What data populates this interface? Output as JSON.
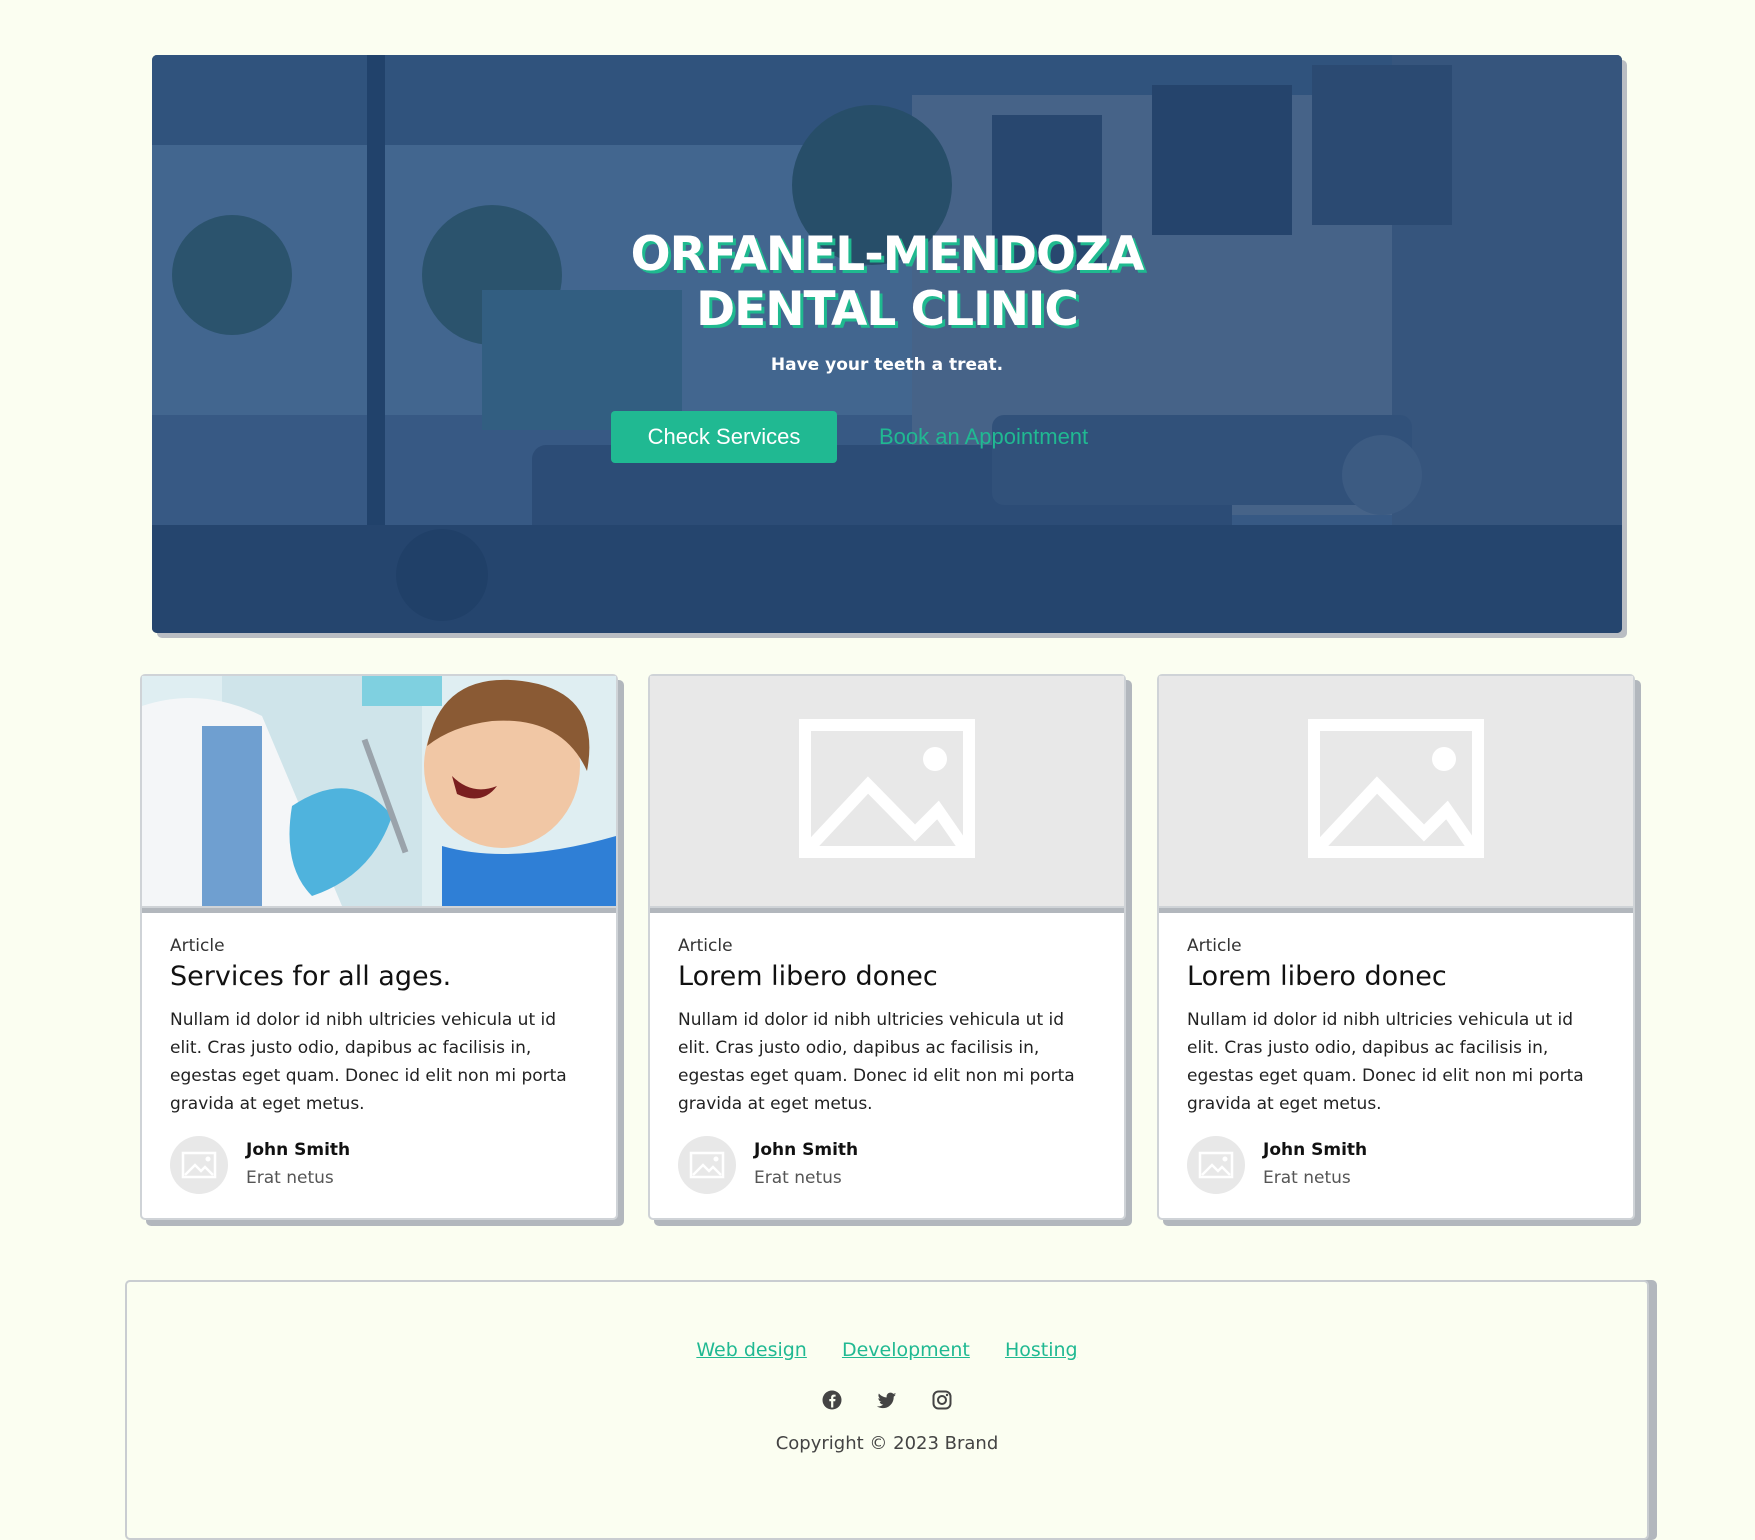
{
  "hero": {
    "title_line1": "ORFANEL-MENDOZA",
    "title_line2": "DENTAL CLINIC",
    "subtitle": "Have your teeth a treat.",
    "primary_button": "Check Services",
    "secondary_button": "Book an Appointment"
  },
  "cards": [
    {
      "kicker": "Article",
      "title": "Services for all ages.",
      "text": "Nullam id dolor id nibh ultricies vehicula ut id elit. Cras justo odio, dapibus ac facilisis in, egestas eget quam. Donec id elit non mi porta gravida at eget metus.",
      "author_name": "John Smith",
      "author_role": "Erat netus",
      "image": "dentist-child-photo"
    },
    {
      "kicker": "Article",
      "title": "Lorem libero donec",
      "text": "Nullam id dolor id nibh ultricies vehicula ut id elit. Cras justo odio, dapibus ac facilisis in, egestas eget quam. Donec id elit non mi porta gravida at eget metus.",
      "author_name": "John Smith",
      "author_role": "Erat netus",
      "image": "image-placeholder-icon"
    },
    {
      "kicker": "Article",
      "title": "Lorem libero donec",
      "text": "Nullam id dolor id nibh ultricies vehicula ut id elit. Cras justo odio, dapibus ac facilisis in, egestas eget quam. Donec id elit non mi porta gravida at eget metus.",
      "author_name": "John Smith",
      "author_role": "Erat netus",
      "image": "image-placeholder-icon"
    }
  ],
  "footer": {
    "links": [
      "Web design",
      "Development",
      "Hosting"
    ],
    "social_icons": [
      "facebook-icon",
      "twitter-icon",
      "instagram-icon"
    ],
    "copyright": "Copyright © 2023 Brand"
  },
  "colors": {
    "page_background": "#fbfef1",
    "accent": "#20b992",
    "hero_overlay": "#1c4880"
  }
}
